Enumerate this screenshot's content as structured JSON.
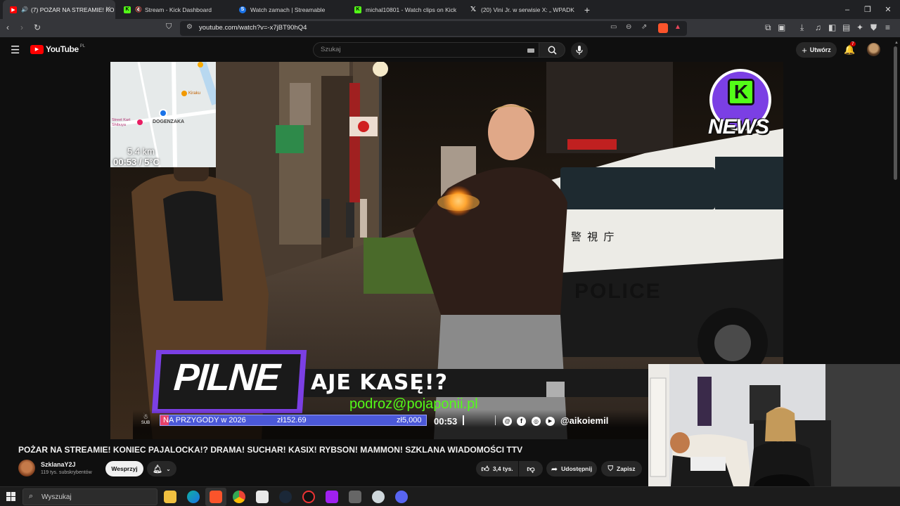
{
  "browser": {
    "tabs": [
      {
        "title": "(7) POŻAR NA STREAMIE! KO",
        "favicon": "youtube",
        "color": "#ff0000",
        "active": true
      },
      {
        "title": "Stream - Kick Dashboard",
        "favicon": "kick",
        "color": "#53fc18",
        "active": false
      },
      {
        "title": "Watch zamach | Streamable",
        "favicon": "streamable",
        "color": "#1a73e8",
        "active": false
      },
      {
        "title": "michal10801 - Watch clips on Kick",
        "favicon": "kick",
        "color": "#53fc18",
        "active": false
      },
      {
        "title": "(20) Vini Jr. w serwisie X: „ WPADK",
        "favicon": "x",
        "color": "#ffffff",
        "active": false
      }
    ],
    "new_tab": "+",
    "url": "youtube.com/watch?v=-x7jBT90hQ4",
    "window_controls": [
      "–",
      "❐",
      "✕"
    ]
  },
  "youtube": {
    "logo": "YouTube",
    "region": "PL",
    "search_placeholder": "Szukaj",
    "create_label": "Utwórz",
    "notifications_count": "7",
    "video": {
      "map_distance": "5.4 km",
      "map_time_temp": "00:53 / 5°C",
      "map_labels": [
        "Kiraku",
        "Street Kart Shibuya",
        "DOGENZAKA"
      ],
      "brand_badge": "NEWS",
      "police_text": "POLICE",
      "police_kanji": "警 視 庁",
      "breaking_label": "PILNE",
      "headline": "AJE KASĘ!?",
      "email": "podroz@pojaponii.pl",
      "goal_label": "NA PRZYGODY w 2026",
      "goal_current": "zł152.69",
      "goal_target": "zł5,000",
      "goal_progress": 0.0305,
      "timer": "00:53",
      "social_handle": "@aikoiemil",
      "sub_label": "SUB"
    },
    "title": "POŻAR NA STREAMIE! KONIEC PAJALOCKA!? DRAMA! SUCHAR! KASIX! RYBSON! MAMMON! SZKLANA WIADOMOŚCI TTV",
    "channel": {
      "name": "SzklanaY2J",
      "subscribers": "119 tys. subskrybentów",
      "support_label": "Wesprzyj"
    },
    "actions": {
      "likes": "3,4 tys.",
      "share": "Udostępnij",
      "save": "Zapisz"
    }
  },
  "taskbar": {
    "search_placeholder": "Wyszukaj"
  }
}
